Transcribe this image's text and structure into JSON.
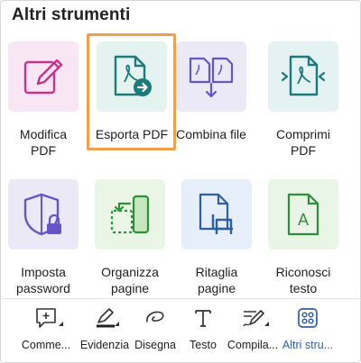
{
  "section_title": "Altri strumenti",
  "tools": [
    {
      "label": "Modifica PDF",
      "icon": "edit-pdf-icon",
      "tile_color": "#f9e6f4"
    },
    {
      "label": "Esporta PDF",
      "icon": "export-pdf-icon",
      "tile_color": "#e4f2f0",
      "selected": true
    },
    {
      "label": "Combina file",
      "icon": "combine-files-icon",
      "tile_color": "#ece9f7"
    },
    {
      "label": "Comprimi PDF",
      "icon": "compress-pdf-icon",
      "tile_color": "#e4f2f3"
    },
    {
      "label": "Imposta password",
      "icon": "protect-password-icon",
      "tile_color": "#ece9f7"
    },
    {
      "label": "Organizza pagine",
      "icon": "organize-pages-icon",
      "tile_color": "#eaf5e6"
    },
    {
      "label": "Ritaglia pagine",
      "icon": "crop-pages-icon",
      "tile_color": "#e5eef9"
    },
    {
      "label": "Riconosci testo",
      "icon": "ocr-text-icon",
      "tile_color": "#e8f5e7"
    }
  ],
  "toolbar": [
    {
      "label": "Comme...",
      "icon": "comment-icon"
    },
    {
      "label": "Evidenzia",
      "icon": "highlighter-icon"
    },
    {
      "label": "Disegna",
      "icon": "draw-icon"
    },
    {
      "label": "Testo",
      "icon": "text-icon"
    },
    {
      "label": "Compila...",
      "icon": "fill-sign-icon"
    },
    {
      "label": "Altri stru...",
      "icon": "more-tools-icon",
      "active": true
    }
  ],
  "colors": {
    "highlight": "#f0a04b",
    "magenta": "#c2358f",
    "teal": "#1c7a7a",
    "purple": "#6456c8",
    "green": "#2d8f3a",
    "blue": "#2c5fa8"
  }
}
